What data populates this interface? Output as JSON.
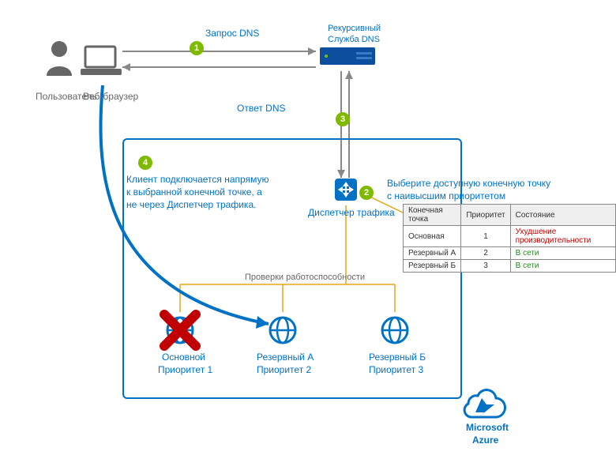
{
  "labels": {
    "user": "Пользователь",
    "browser": "Веб-браузер",
    "dns_query": "Запрос DNS",
    "dns_recursive_line1": "Рекурсивный",
    "dns_recursive_line2": "Служба DNS",
    "dns_response": "Ответ DNS",
    "client_connects_line1": "Клиент подключается напрямую",
    "client_connects_line2": "к выбранной конечной точке, а",
    "client_connects_line3": "не через Диспетчер трафика.",
    "traffic_manager": "Диспетчер трафика",
    "choose_endpoint_line1": "Выберите доступную конечную точку",
    "choose_endpoint_line2": "с наивысшим приоритетом",
    "health_checks": "Проверки работоспособности",
    "endpoint_primary_line1": "Основной",
    "endpoint_primary_line2": "Приоритет 1",
    "endpoint_backup_a_line1": "Резервный A",
    "endpoint_backup_a_line2": "Приоритет 2",
    "endpoint_backup_b_line1": "Резервный Б",
    "endpoint_backup_b_line2": "Приоритет 3",
    "azure_line1": "Microsoft",
    "azure_line2": "Azure"
  },
  "badges": {
    "b1": "1",
    "b2": "2",
    "b3": "3",
    "b4": "4"
  },
  "table": {
    "headers": {
      "endpoint": "Конечная точка",
      "priority": "Приоритет",
      "status": "Состояние"
    },
    "rows": [
      {
        "endpoint": "Основная",
        "priority": "1",
        "status": "Ухудшение производительности",
        "status_class": "degraded"
      },
      {
        "endpoint": "Резервный A",
        "priority": "2",
        "status": "В сети",
        "status_class": "online"
      },
      {
        "endpoint": "Резервный Б",
        "priority": "3",
        "status": "В сети",
        "status_class": "online"
      }
    ]
  },
  "icons": {
    "user": "user-icon",
    "browser": "laptop-icon",
    "dns_server": "server-icon",
    "traffic_manager": "traffic-manager-icon",
    "endpoint": "globe-icon",
    "failed": "x-icon",
    "azure_cloud": "azure-cloud-icon"
  }
}
